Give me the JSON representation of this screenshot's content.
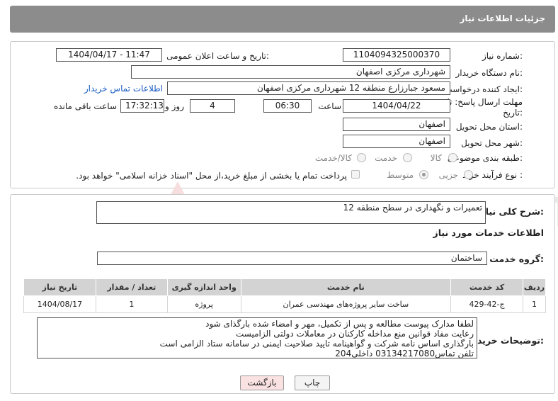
{
  "header": {
    "title": "جزئیات اطلاعات نیاز"
  },
  "watermark": {
    "text": "AriaTender.neT"
  },
  "fields": {
    "need_number_label": "شماره نیاز:",
    "need_number": "1104094325000370",
    "announce_label": "تاریخ و ساعت اعلان عمومی:",
    "announce_value": "1404/04/17 - 11:47",
    "buyer_org_label": "نام دستگاه خریدار:",
    "buyer_org": "شهرداری مرکزی اصفهان",
    "creator_label": "ایجاد کننده درخواست:",
    "creator": "مسعود جبارزارع منطقه 12 شهرداری مرکزی اصفهان",
    "contact_link": "اطلاعات تماس خریدار",
    "deadline_label_1": "مهلت ارسال پاسخ: تا",
    "deadline_label_2": "تاریخ:",
    "deadline_date": "1404/04/22",
    "time_label": "ساعت",
    "deadline_time": "06:30",
    "days_value": "4",
    "days_label": "روز و",
    "remaining_time": "17:32:13",
    "remaining_label": "ساعت باقی مانده",
    "province_label": "استان محل تحویل:",
    "province": "اصفهان",
    "city_label": "شهر محل تحویل:",
    "city": "اصفهان",
    "category_label": "طبقه بندی موضوعی:",
    "category_options": [
      "کالا",
      "خدمت",
      "کالا/خدمت"
    ],
    "purchase_type_label": "نوع فرآیند خرید :",
    "purchase_options": [
      "جزیی",
      "متوسط"
    ],
    "payment_note": "پرداخت تمام یا بخشی از مبلغ خرید،از محل \"اسناد خزانه اسلامی\" خواهد بود."
  },
  "description": {
    "label": "شرح کلی نیاز:",
    "value": "تعمیرات و نگهداری در سطح منطقه 12"
  },
  "services": {
    "title": "اطلاعات خدمات مورد نیاز",
    "group_label": "گروه خدمت:",
    "group_value": "ساختمان",
    "columns": [
      "ردیف",
      "کد خدمت",
      "نام خدمت",
      "واحد اندازه گیری",
      "تعداد / مقدار",
      "تاریخ نیاز"
    ],
    "rows": [
      [
        "1",
        "ج-42-429",
        "ساخت سایر پروژه‌های مهندسی عمران",
        "پروژه",
        "1",
        "1404/08/17"
      ]
    ]
  },
  "buyer_notes": {
    "label": "توضیحات خریدار:",
    "lines": [
      "لطفا مدارک پیوست مطالعه و پس از تکمیل، مهر و امضاء شده بارگذای شود",
      "رعایت مفاد قوانین منع مداخله کارکنان در معاملات دولتی الزامیست",
      "بارگذاری اساس نامه شرکت و گواهینامه تایید صلاحیت ایمنی در سامانه ستاد الزامی است",
      "تلفن تماس03134217080 داخلی204"
    ]
  },
  "buttons": {
    "print": "چاپ",
    "back": "بازگشت"
  }
}
